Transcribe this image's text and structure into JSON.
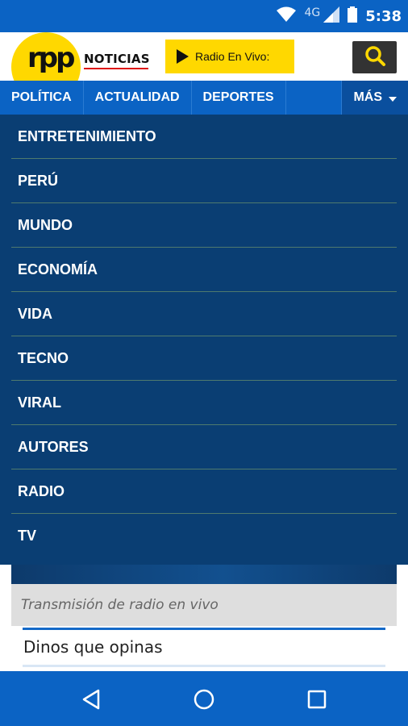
{
  "status_bar": {
    "time": "5:38",
    "network": "4G"
  },
  "header": {
    "logo_text": "RPP",
    "brand_label": "NOTICIAS",
    "radio_button_label": "Radio En Vivo:"
  },
  "nav": {
    "tabs": [
      "POLÍTICA",
      "ACTUALIDAD",
      "DEPORTES"
    ],
    "more_label": "MÁS"
  },
  "menu": {
    "items": [
      "ENTRETENIMIENTO",
      "PERÚ",
      "MUNDO",
      "ECONOMÍA",
      "VIDA",
      "TECNO",
      "VIRAL",
      "AUTORES",
      "RADIO",
      "TV"
    ]
  },
  "content": {
    "live_bar_text": "Transmisión de radio en vivo",
    "opinion_prompt": "Dinos que opinas"
  },
  "colors": {
    "header_blue": "#0b63c4",
    "menu_blue": "#0a3e73",
    "brand_yellow": "#ffd800"
  }
}
